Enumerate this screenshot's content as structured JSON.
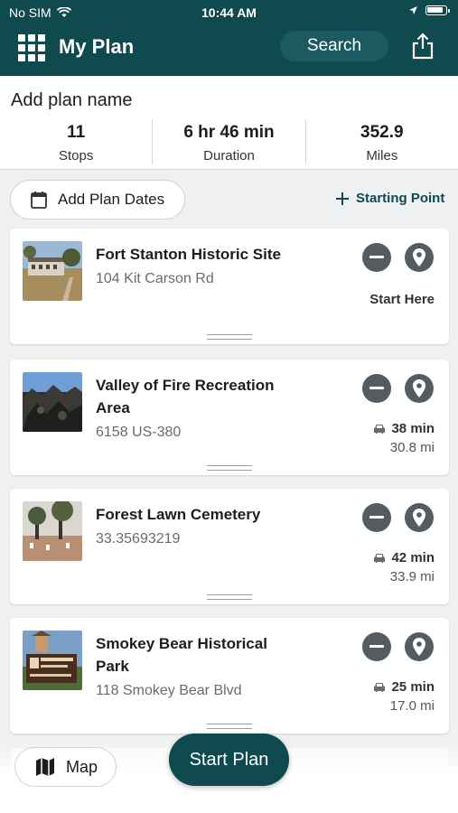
{
  "status_bar": {
    "carrier": "No SIM",
    "time": "10:44 AM"
  },
  "header": {
    "title": "My Plan",
    "search_label": "Search"
  },
  "summary": {
    "plan_name": "Add plan name",
    "stats": [
      {
        "value": "11",
        "label": "Stops"
      },
      {
        "value": "6 hr 46 min",
        "label": "Duration"
      },
      {
        "value": "352.9",
        "label": "Miles"
      }
    ]
  },
  "actions": {
    "add_dates": "Add Plan Dates",
    "starting_point": "Starting Point"
  },
  "stops": [
    {
      "name": "Fort Stanton Historic Site",
      "address": "104 Kit Carson Rd",
      "start_label": "Start Here"
    },
    {
      "name": "Valley of Fire Recreation Area",
      "address": "6158 US-380",
      "drive_time": "38 min",
      "distance": "30.8 mi"
    },
    {
      "name": "Forest Lawn Cemetery",
      "address": "33.35693219",
      "drive_time": "42 min",
      "distance": "33.9 mi"
    },
    {
      "name": "Smokey Bear Historical Park",
      "address": "118 Smokey Bear Blvd",
      "drive_time": "25 min",
      "distance": "17.0 mi"
    }
  ],
  "bottom": {
    "map_label": "Map",
    "start_plan_label": "Start Plan"
  },
  "colors": {
    "brand": "#0f4a4f",
    "icon_bg": "#555b5e"
  },
  "icons": [
    "grid-icon",
    "share-icon",
    "calendar-icon",
    "plus-icon",
    "remove-icon",
    "pin-icon",
    "car-icon",
    "map-icon",
    "wifi-icon",
    "location-icon",
    "battery-icon"
  ]
}
